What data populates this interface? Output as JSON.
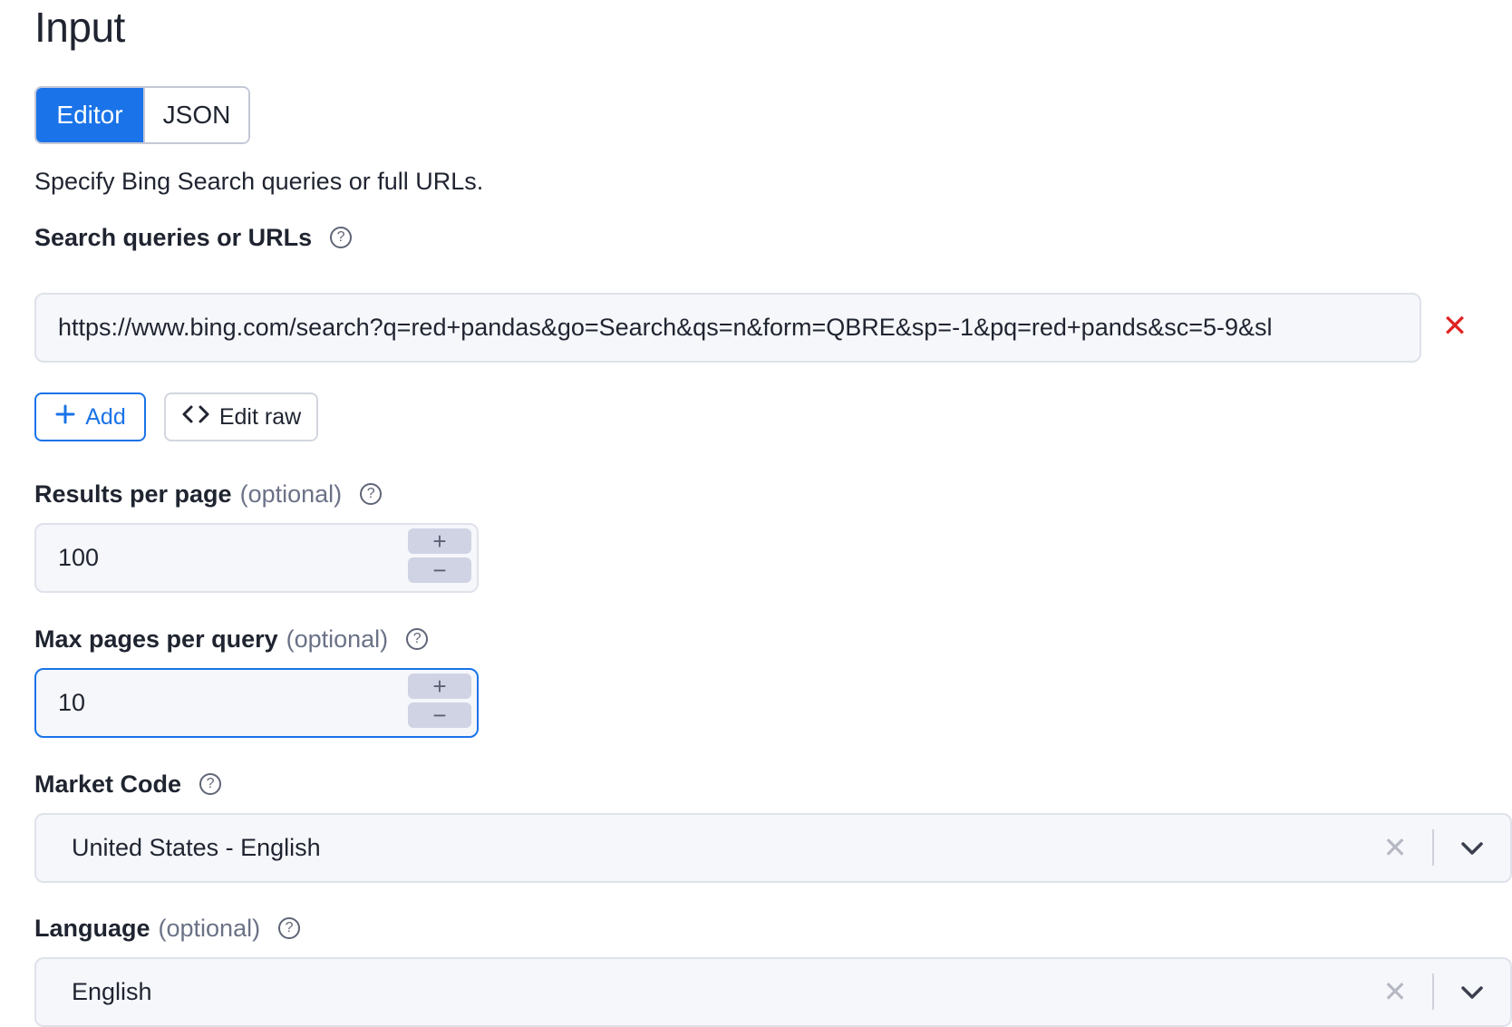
{
  "header": {
    "title": "Input"
  },
  "mode_tabs": {
    "editor": "Editor",
    "json": "JSON"
  },
  "description": "Specify Bing Search queries or full URLs.",
  "search_queries": {
    "label": "Search queries or URLs",
    "value": "https://www.bing.com/search?q=red+pandas&go=Search&qs=n&form=QBRE&sp=-1&pq=red+pands&sc=5-9&sl",
    "add_label": "Add",
    "edit_raw_label": "Edit raw"
  },
  "results_per_page": {
    "label": "Results per page",
    "optional": "(optional)",
    "value": "100"
  },
  "max_pages": {
    "label": "Max pages per query",
    "optional": "(optional)",
    "value": "10"
  },
  "market_code": {
    "label": "Market Code",
    "value": "United States - English"
  },
  "language": {
    "label": "Language",
    "optional": "(optional)",
    "value": "English"
  },
  "colors": {
    "accent": "#1a73e8",
    "danger": "#e02424"
  }
}
